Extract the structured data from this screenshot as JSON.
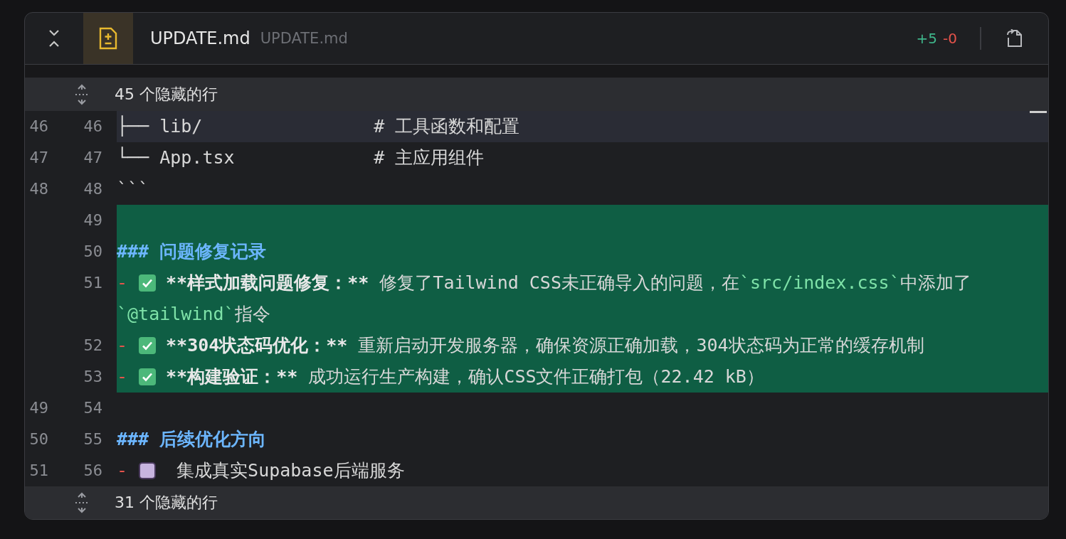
{
  "header": {
    "filename": "UPDATE.md",
    "path": "UPDATE.md",
    "additions": "+5",
    "deletions": "-0"
  },
  "hidden_top": {
    "label": "45 个隐藏的行"
  },
  "lines": [
    {
      "old": "46",
      "new": "46",
      "kind": "context",
      "selected": true,
      "tokens": [
        {
          "kind": "text",
          "text": "├── lib/                # 工具函数和配置"
        }
      ]
    },
    {
      "old": "47",
      "new": "47",
      "kind": "context",
      "selected": false,
      "tokens": [
        {
          "kind": "text",
          "text": "└── App.tsx             # 主应用组件"
        }
      ]
    },
    {
      "old": "48",
      "new": "48",
      "kind": "context",
      "selected": false,
      "tokens": [
        {
          "kind": "text",
          "text": "```"
        }
      ]
    },
    {
      "new": "49",
      "kind": "added",
      "selected": false
    },
    {
      "new": "50",
      "kind": "added",
      "selected": false,
      "tokens": [
        {
          "kind": "heading",
          "text": "### 问题修复记录"
        }
      ]
    },
    {
      "new": "51",
      "kind": "added",
      "selected": false,
      "tokens": [
        {
          "kind": "dash",
          "text": "-"
        },
        {
          "kind": "checkbox",
          "checked": true
        },
        {
          "kind": "bold",
          "text": "**样式加载问题修复：**"
        },
        {
          "kind": "text",
          "text": " 修复了Tailwind CSS未正确导入的问题，在"
        },
        {
          "kind": "code",
          "text": "`src/index.css`"
        },
        {
          "kind": "text",
          "text": "中添加了"
        },
        {
          "kind": "code",
          "text": "`@tailwind`"
        },
        {
          "kind": "text",
          "text": "指令"
        }
      ]
    },
    {
      "new": "52",
      "kind": "added",
      "selected": false,
      "tokens": [
        {
          "kind": "dash",
          "text": "-"
        },
        {
          "kind": "checkbox",
          "checked": true
        },
        {
          "kind": "bold",
          "text": "**304状态码优化：**"
        },
        {
          "kind": "text",
          "text": " 重新启动开发服务器，确保资源正确加载，304状态码为正常的缓存机制"
        }
      ]
    },
    {
      "new": "53",
      "kind": "added",
      "selected": false,
      "tokens": [
        {
          "kind": "dash",
          "text": "-"
        },
        {
          "kind": "checkbox",
          "checked": true
        },
        {
          "kind": "bold",
          "text": "**构建验证：**"
        },
        {
          "kind": "text",
          "text": " 成功运行生产构建，确认CSS文件正确打包（22.42 kB）"
        }
      ]
    },
    {
      "old": "49",
      "new": "54",
      "kind": "context",
      "selected": false
    },
    {
      "old": "50",
      "new": "55",
      "kind": "context",
      "selected": false,
      "tokens": [
        {
          "kind": "heading",
          "text": "### 后续优化方向"
        }
      ]
    },
    {
      "old": "51",
      "new": "56",
      "kind": "context",
      "selected": false,
      "tokens": [
        {
          "kind": "dash",
          "text": "-"
        },
        {
          "kind": "checkbox",
          "checked": false
        },
        {
          "kind": "text",
          "text": " 集成真实Supabase后端服务"
        }
      ]
    }
  ],
  "hidden_bottom": {
    "label": "31 个隐藏的行"
  }
}
